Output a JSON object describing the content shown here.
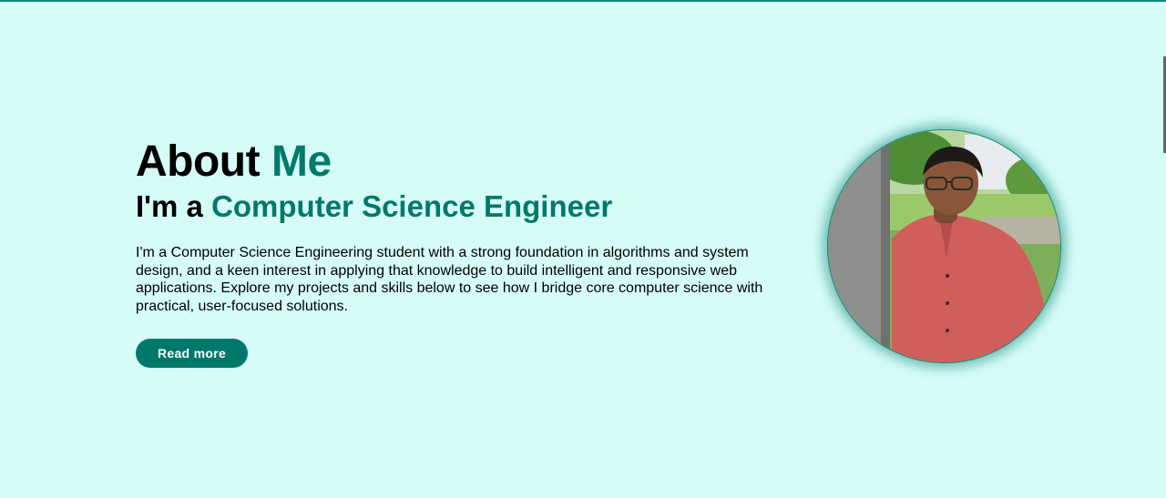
{
  "about": {
    "heading_prefix": "About",
    "heading_accent": "Me",
    "subheading_prefix": "I'm a",
    "subheading_accent": "Computer Science Engineer",
    "bio": "I'm a Computer Science Engineering student with a strong foundation in algorithms and system design, and a keen interest in applying that knowledge to build intelligent and responsive web applications. Explore my projects and skills below to see how I bridge core computer science with practical, user-focused solutions.",
    "read_more_label": "Read more"
  },
  "colors": {
    "background": "#d6fcf8",
    "accent": "#00796b",
    "button_text": "#ffffff"
  },
  "icons": {
    "profile": "profile-photo"
  }
}
